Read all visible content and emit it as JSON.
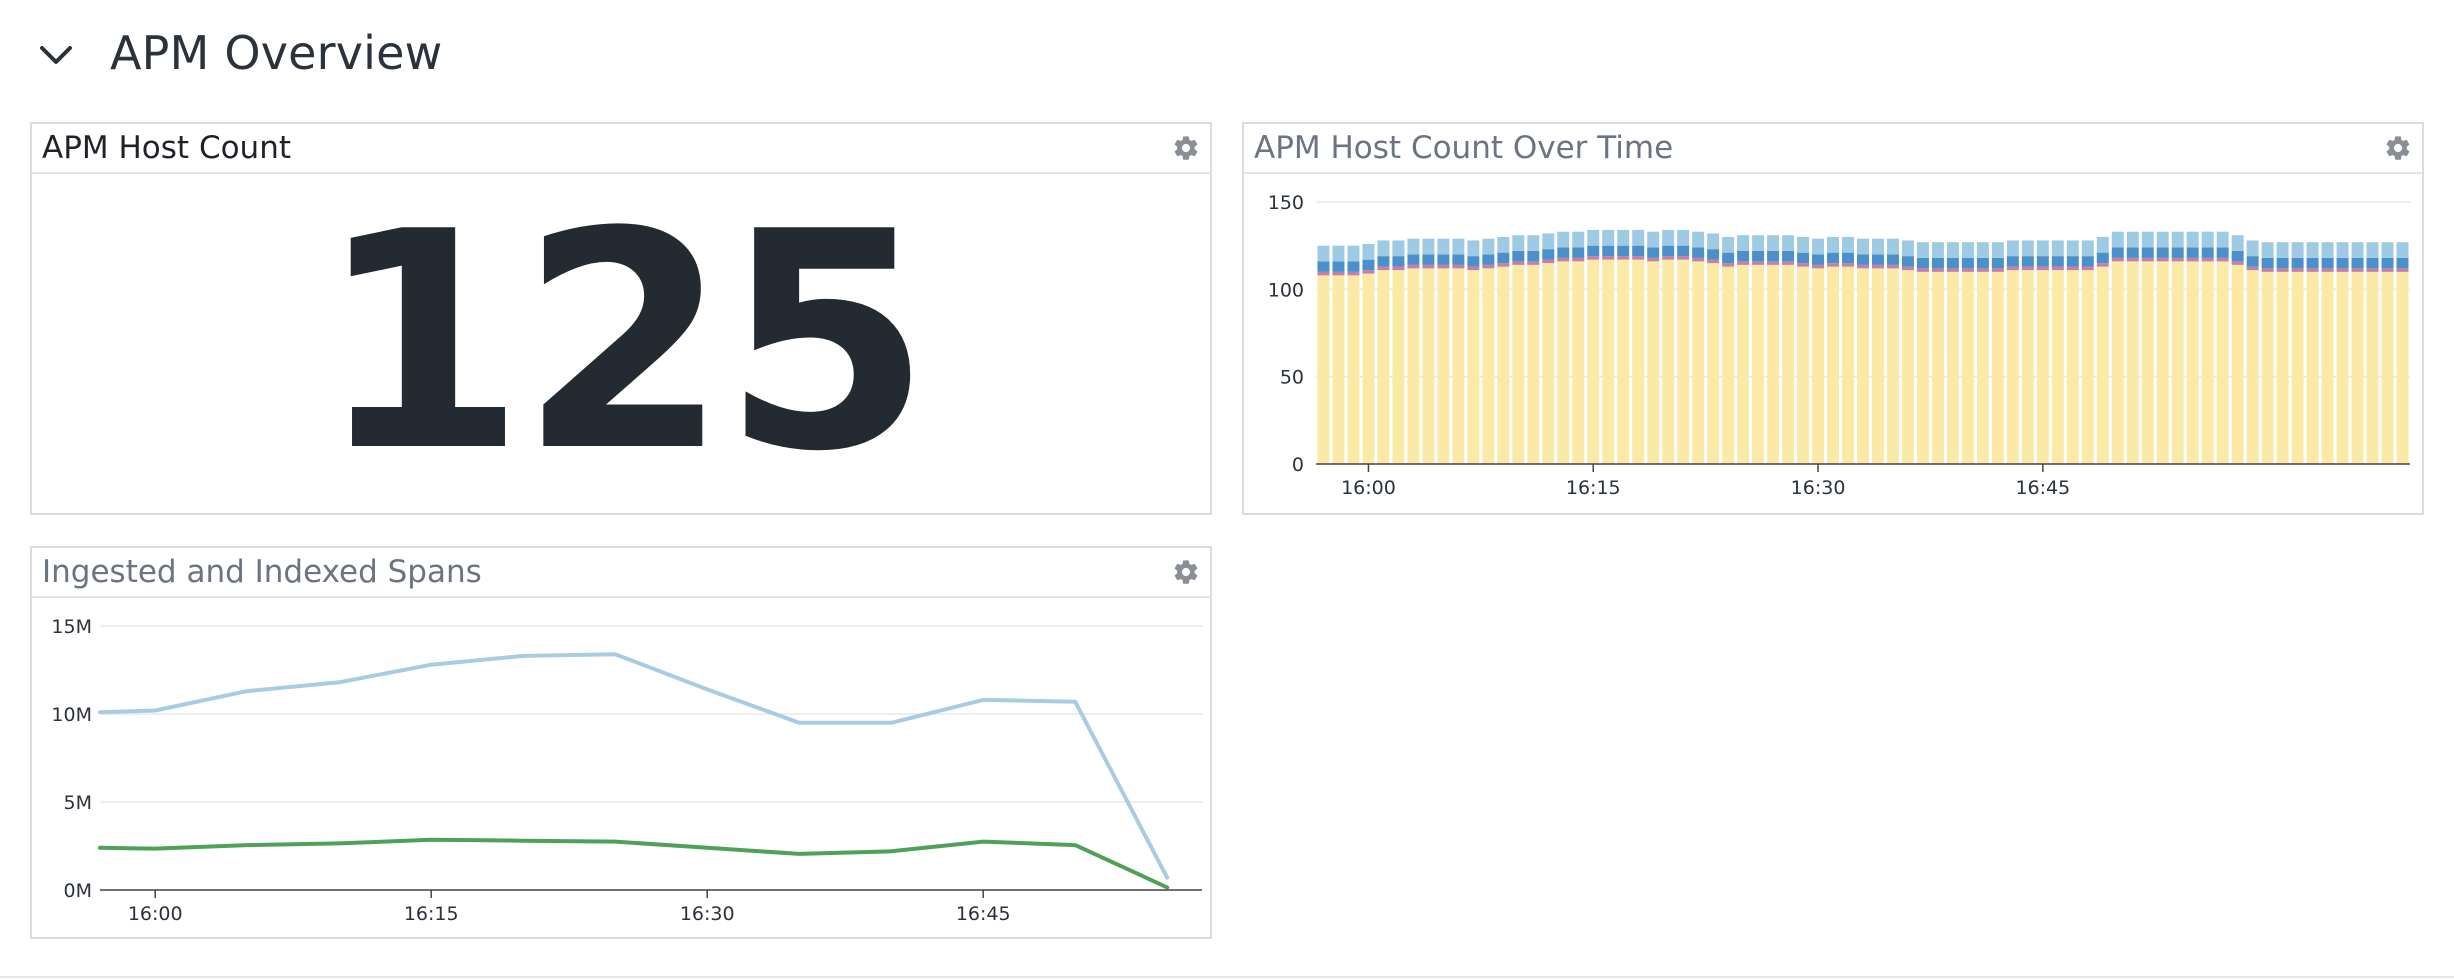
{
  "section": {
    "title": "APM Overview",
    "chevron_icon": "chevron-down-icon"
  },
  "widgets": {
    "host_count": {
      "title": "APM Host Count",
      "value": "125",
      "gear_icon": "gear-icon"
    },
    "host_over_time": {
      "title": "APM Host Count Over Time",
      "gear_icon": "gear-icon"
    },
    "spans": {
      "title": "Ingested and Indexed Spans",
      "gear_icon": "gear-icon"
    }
  },
  "colors": {
    "bar_base": "#fbe9a6",
    "bar_pink": "#c77fa6",
    "bar_mid": "#4b8fcb",
    "bar_top": "#9fcae4",
    "line_ingested": "#a9cce3",
    "line_indexed": "#4fa158",
    "grid": "#e6e8eb",
    "axis": "#444"
  },
  "chart_data": [
    {
      "type": "bar",
      "stacked": true,
      "title": "APM Host Count Over Time",
      "ylim": [
        0,
        150
      ],
      "yticks": [
        "0",
        "50",
        "100",
        "150"
      ],
      "xticks": [
        "16:00",
        "16:15",
        "16:30",
        "16:45"
      ],
      "x_start": "15:57",
      "x_step_minutes": 1,
      "series": [
        {
          "values": [
            108,
            108,
            108,
            109,
            111,
            111,
            112,
            112,
            112,
            112,
            111,
            112,
            113,
            114,
            114,
            115,
            116,
            116,
            117,
            117,
            117,
            117,
            116,
            117,
            117,
            116,
            115,
            113,
            114,
            114,
            114,
            114,
            113,
            112,
            113,
            113,
            112,
            112,
            112,
            111,
            110,
            110,
            110,
            110,
            110,
            110,
            111,
            111,
            111,
            111,
            111,
            111,
            113,
            116,
            116,
            116,
            116,
            116,
            116,
            116,
            116,
            114,
            111,
            110,
            110,
            110,
            110,
            110,
            110,
            110,
            110,
            110,
            110
          ]
        },
        {
          "values": [
            2,
            2,
            2,
            2,
            2,
            2,
            2,
            2,
            2,
            2,
            2,
            2,
            2,
            2,
            2,
            2,
            2,
            2,
            2,
            2,
            2,
            2,
            2,
            2,
            2,
            2,
            2,
            2,
            2,
            2,
            2,
            2,
            2,
            2,
            2,
            2,
            2,
            2,
            2,
            2,
            2,
            2,
            2,
            2,
            2,
            2,
            2,
            2,
            2,
            2,
            2,
            2,
            2,
            2,
            2,
            2,
            2,
            2,
            2,
            2,
            2,
            2,
            2,
            2,
            2,
            2,
            2,
            2,
            2,
            2,
            2,
            2,
            2
          ]
        },
        {
          "values": [
            6,
            6,
            6,
            6,
            6,
            6,
            6,
            6,
            6,
            6,
            6,
            6,
            6,
            6,
            6,
            6,
            6,
            6,
            6,
            6,
            6,
            6,
            6,
            6,
            6,
            6,
            6,
            6,
            6,
            6,
            6,
            6,
            6,
            6,
            6,
            6,
            6,
            6,
            6,
            6,
            6,
            6,
            6,
            6,
            6,
            6,
            6,
            6,
            6,
            6,
            6,
            6,
            6,
            6,
            6,
            6,
            6,
            6,
            6,
            6,
            6,
            6,
            6,
            6,
            6,
            6,
            6,
            6,
            6,
            6,
            6,
            6,
            6
          ]
        },
        {
          "values": [
            9,
            9,
            9,
            9,
            9,
            9,
            9,
            9,
            9,
            9,
            9,
            9,
            9,
            9,
            9,
            9,
            9,
            9,
            9,
            9,
            9,
            9,
            9,
            9,
            9,
            9,
            9,
            9,
            9,
            9,
            9,
            9,
            9,
            9,
            9,
            9,
            9,
            9,
            9,
            9,
            9,
            9,
            9,
            9,
            9,
            9,
            9,
            9,
            9,
            9,
            9,
            9,
            9,
            9,
            9,
            9,
            9,
            9,
            9,
            9,
            9,
            9,
            9,
            9,
            9,
            9,
            9,
            9,
            9,
            9,
            9,
            9,
            9
          ]
        }
      ]
    },
    {
      "type": "line",
      "title": "Ingested and Indexed Spans",
      "ylim": [
        0,
        15000000
      ],
      "yticks": [
        "0M",
        "5M",
        "10M",
        "15M"
      ],
      "xticks": [
        "16:00",
        "16:15",
        "16:30",
        "16:45"
      ],
      "x": [
        "15:57",
        "16:00",
        "16:05",
        "16:10",
        "16:15",
        "16:20",
        "16:25",
        "16:30",
        "16:35",
        "16:40",
        "16:45",
        "16:50",
        "16:55"
      ],
      "series": [
        {
          "values": [
            10100000,
            10200000,
            11300000,
            11800000,
            12800000,
            13300000,
            13400000,
            11400000,
            9500000,
            9500000,
            10800000,
            10700000,
            700000
          ]
        },
        {
          "values": [
            2400000,
            2350000,
            2550000,
            2650000,
            2850000,
            2800000,
            2750000,
            2400000,
            2050000,
            2200000,
            2750000,
            2550000,
            150000
          ]
        }
      ]
    }
  ]
}
